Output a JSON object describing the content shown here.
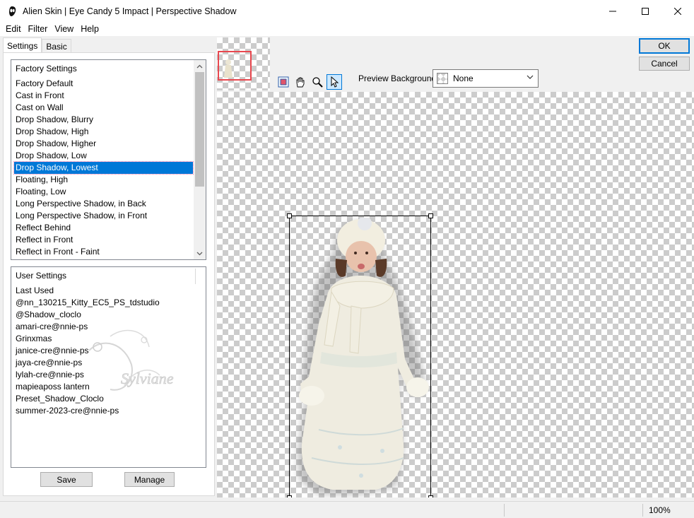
{
  "window": {
    "title": "Alien Skin | Eye Candy 5 Impact | Perspective Shadow",
    "app_icon": "alien-skin-icon"
  },
  "menu": [
    {
      "label": "Edit"
    },
    {
      "label": "Filter"
    },
    {
      "label": "View"
    },
    {
      "label": "Help"
    }
  ],
  "tabs": [
    {
      "label": "Settings",
      "active": true
    },
    {
      "label": "Basic",
      "active": false
    }
  ],
  "factory_settings": {
    "header": "Factory Settings",
    "items": [
      "Factory Default",
      "Cast in Front",
      "Cast on Wall",
      "Drop Shadow, Blurry",
      "Drop Shadow, High",
      "Drop Shadow, Higher",
      "Drop Shadow, Low",
      "Drop Shadow, Lowest",
      "Floating, High",
      "Floating, Low",
      "Long Perspective Shadow, in Back",
      "Long Perspective Shadow, in Front",
      "Reflect Behind",
      "Reflect in Front",
      "Reflect in Front - Faint"
    ],
    "selected": "Drop Shadow, Lowest"
  },
  "user_settings": {
    "header": "User Settings",
    "items": [
      "Last Used",
      "@nn_130215_Kitty_EC5_PS_tdstudio",
      "@Shadow_cloclo",
      "amari-cre@nnie-ps",
      "Grinxmas",
      "janice-cre@nnie-ps",
      "jaya-cre@nnie-ps",
      "lylah-cre@nnie-ps",
      "mapieaposs lantern",
      "Preset_Shadow_Cloclo",
      "summer-2023-cre@nnie-ps"
    ],
    "watermark": "Sylviane"
  },
  "buttons": {
    "save": "Save",
    "manage": "Manage",
    "ok": "OK",
    "cancel": "Cancel"
  },
  "preview_background": {
    "label": "Preview Background:",
    "value": "None"
  },
  "tools": [
    "navigate-icon",
    "hand-icon",
    "zoom-icon",
    "pointer-icon"
  ],
  "status": {
    "zoom": "100%"
  },
  "colors": {
    "selection": "#0078d7",
    "thumb_frame": "#e8484f"
  }
}
